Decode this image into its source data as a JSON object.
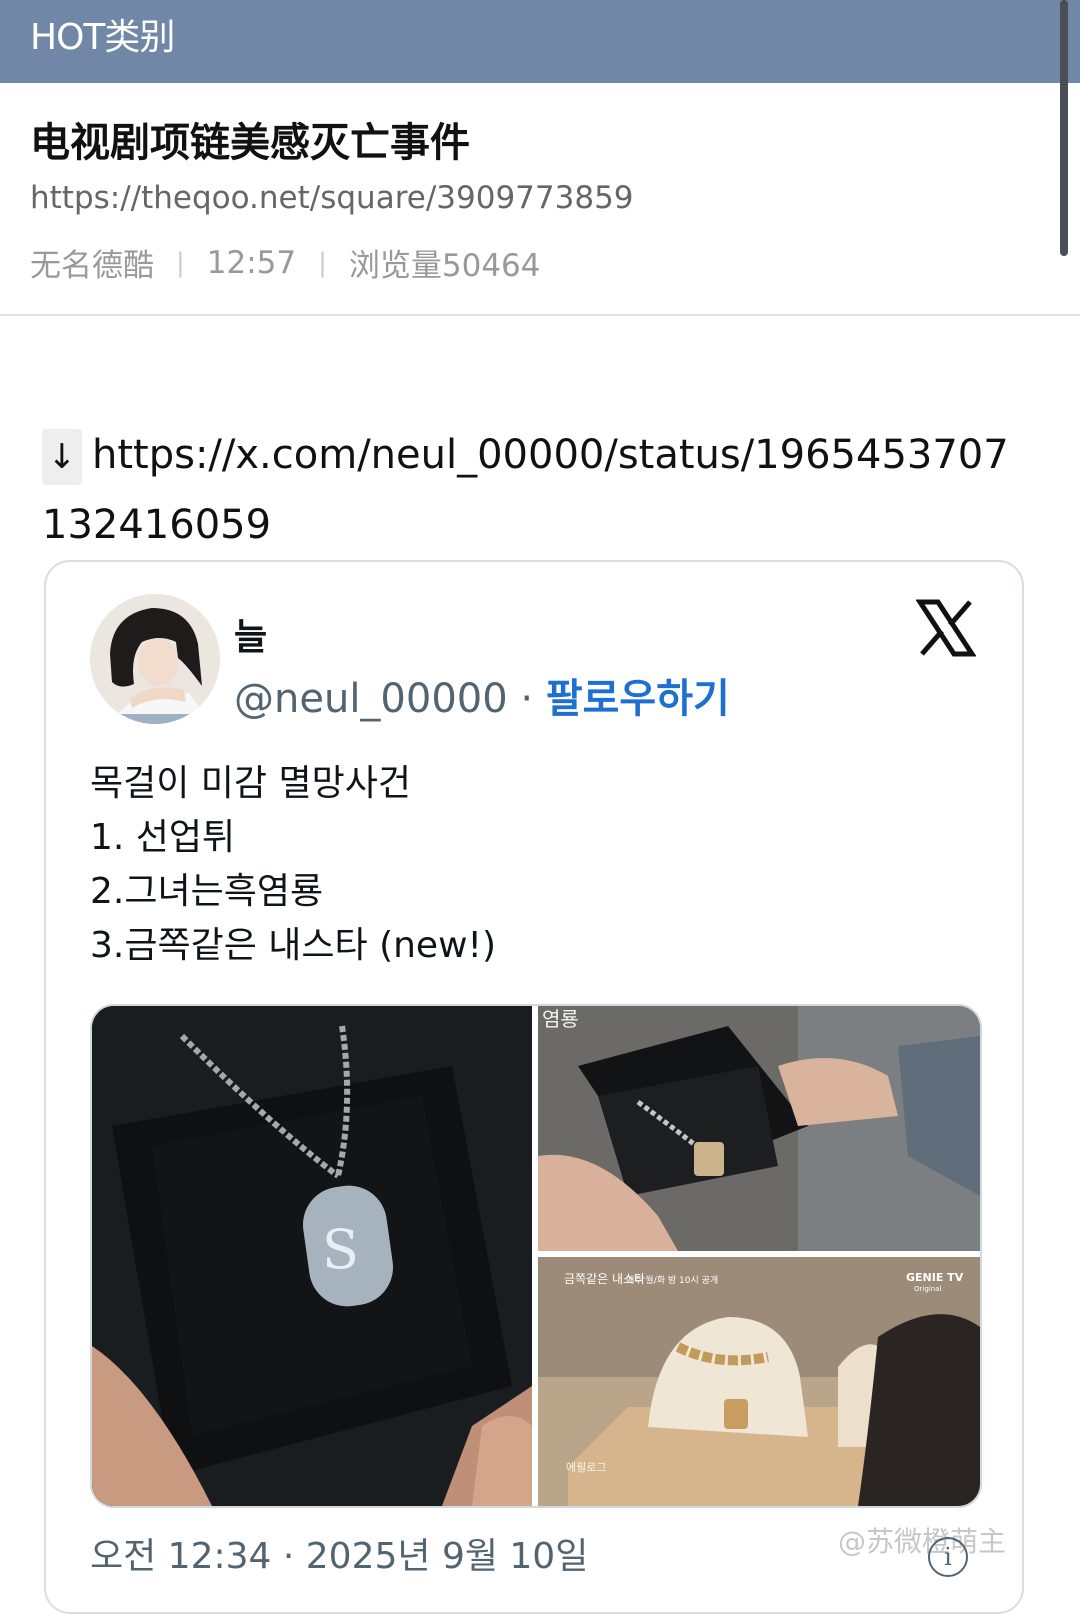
{
  "header": {
    "title": "HOT类别"
  },
  "post": {
    "title": "电视剧项链美感灭亡事件",
    "url": "https://theqoo.net/square/3909773859",
    "author": "无名德酷",
    "time": "12:57",
    "views": "浏览量50464"
  },
  "link": {
    "arrow": "↓",
    "url": "https://x.com/neul_00000/status/1965453707132416059"
  },
  "tweet": {
    "name": "늘",
    "handle": "@neul_00000",
    "dot": "·",
    "follow": "팔로우하기",
    "lines": [
      "목걸이 미감 멸망사건",
      "1. 선업튀",
      "2.그녀는흑염룡",
      "3.금쪽같은 내스타 (new!)"
    ],
    "timestamp": "오전 12:34 · 2025년 9월 10일",
    "media_labels": {
      "image2_caption": "염룡",
      "image3_title": "금쪽같은 내스타",
      "image3_sub": "매주 월/화 밤 10시 공개",
      "image3_brand": "GENIE TV",
      "image3_brand_sub": "Original",
      "image3_corner": "에필로그"
    }
  },
  "watermark": "@苏微橙萌主",
  "info_icon": "i",
  "colors": {
    "header_bg": "#7087a8",
    "follow": "#1d6fd1",
    "handle": "#536471"
  }
}
